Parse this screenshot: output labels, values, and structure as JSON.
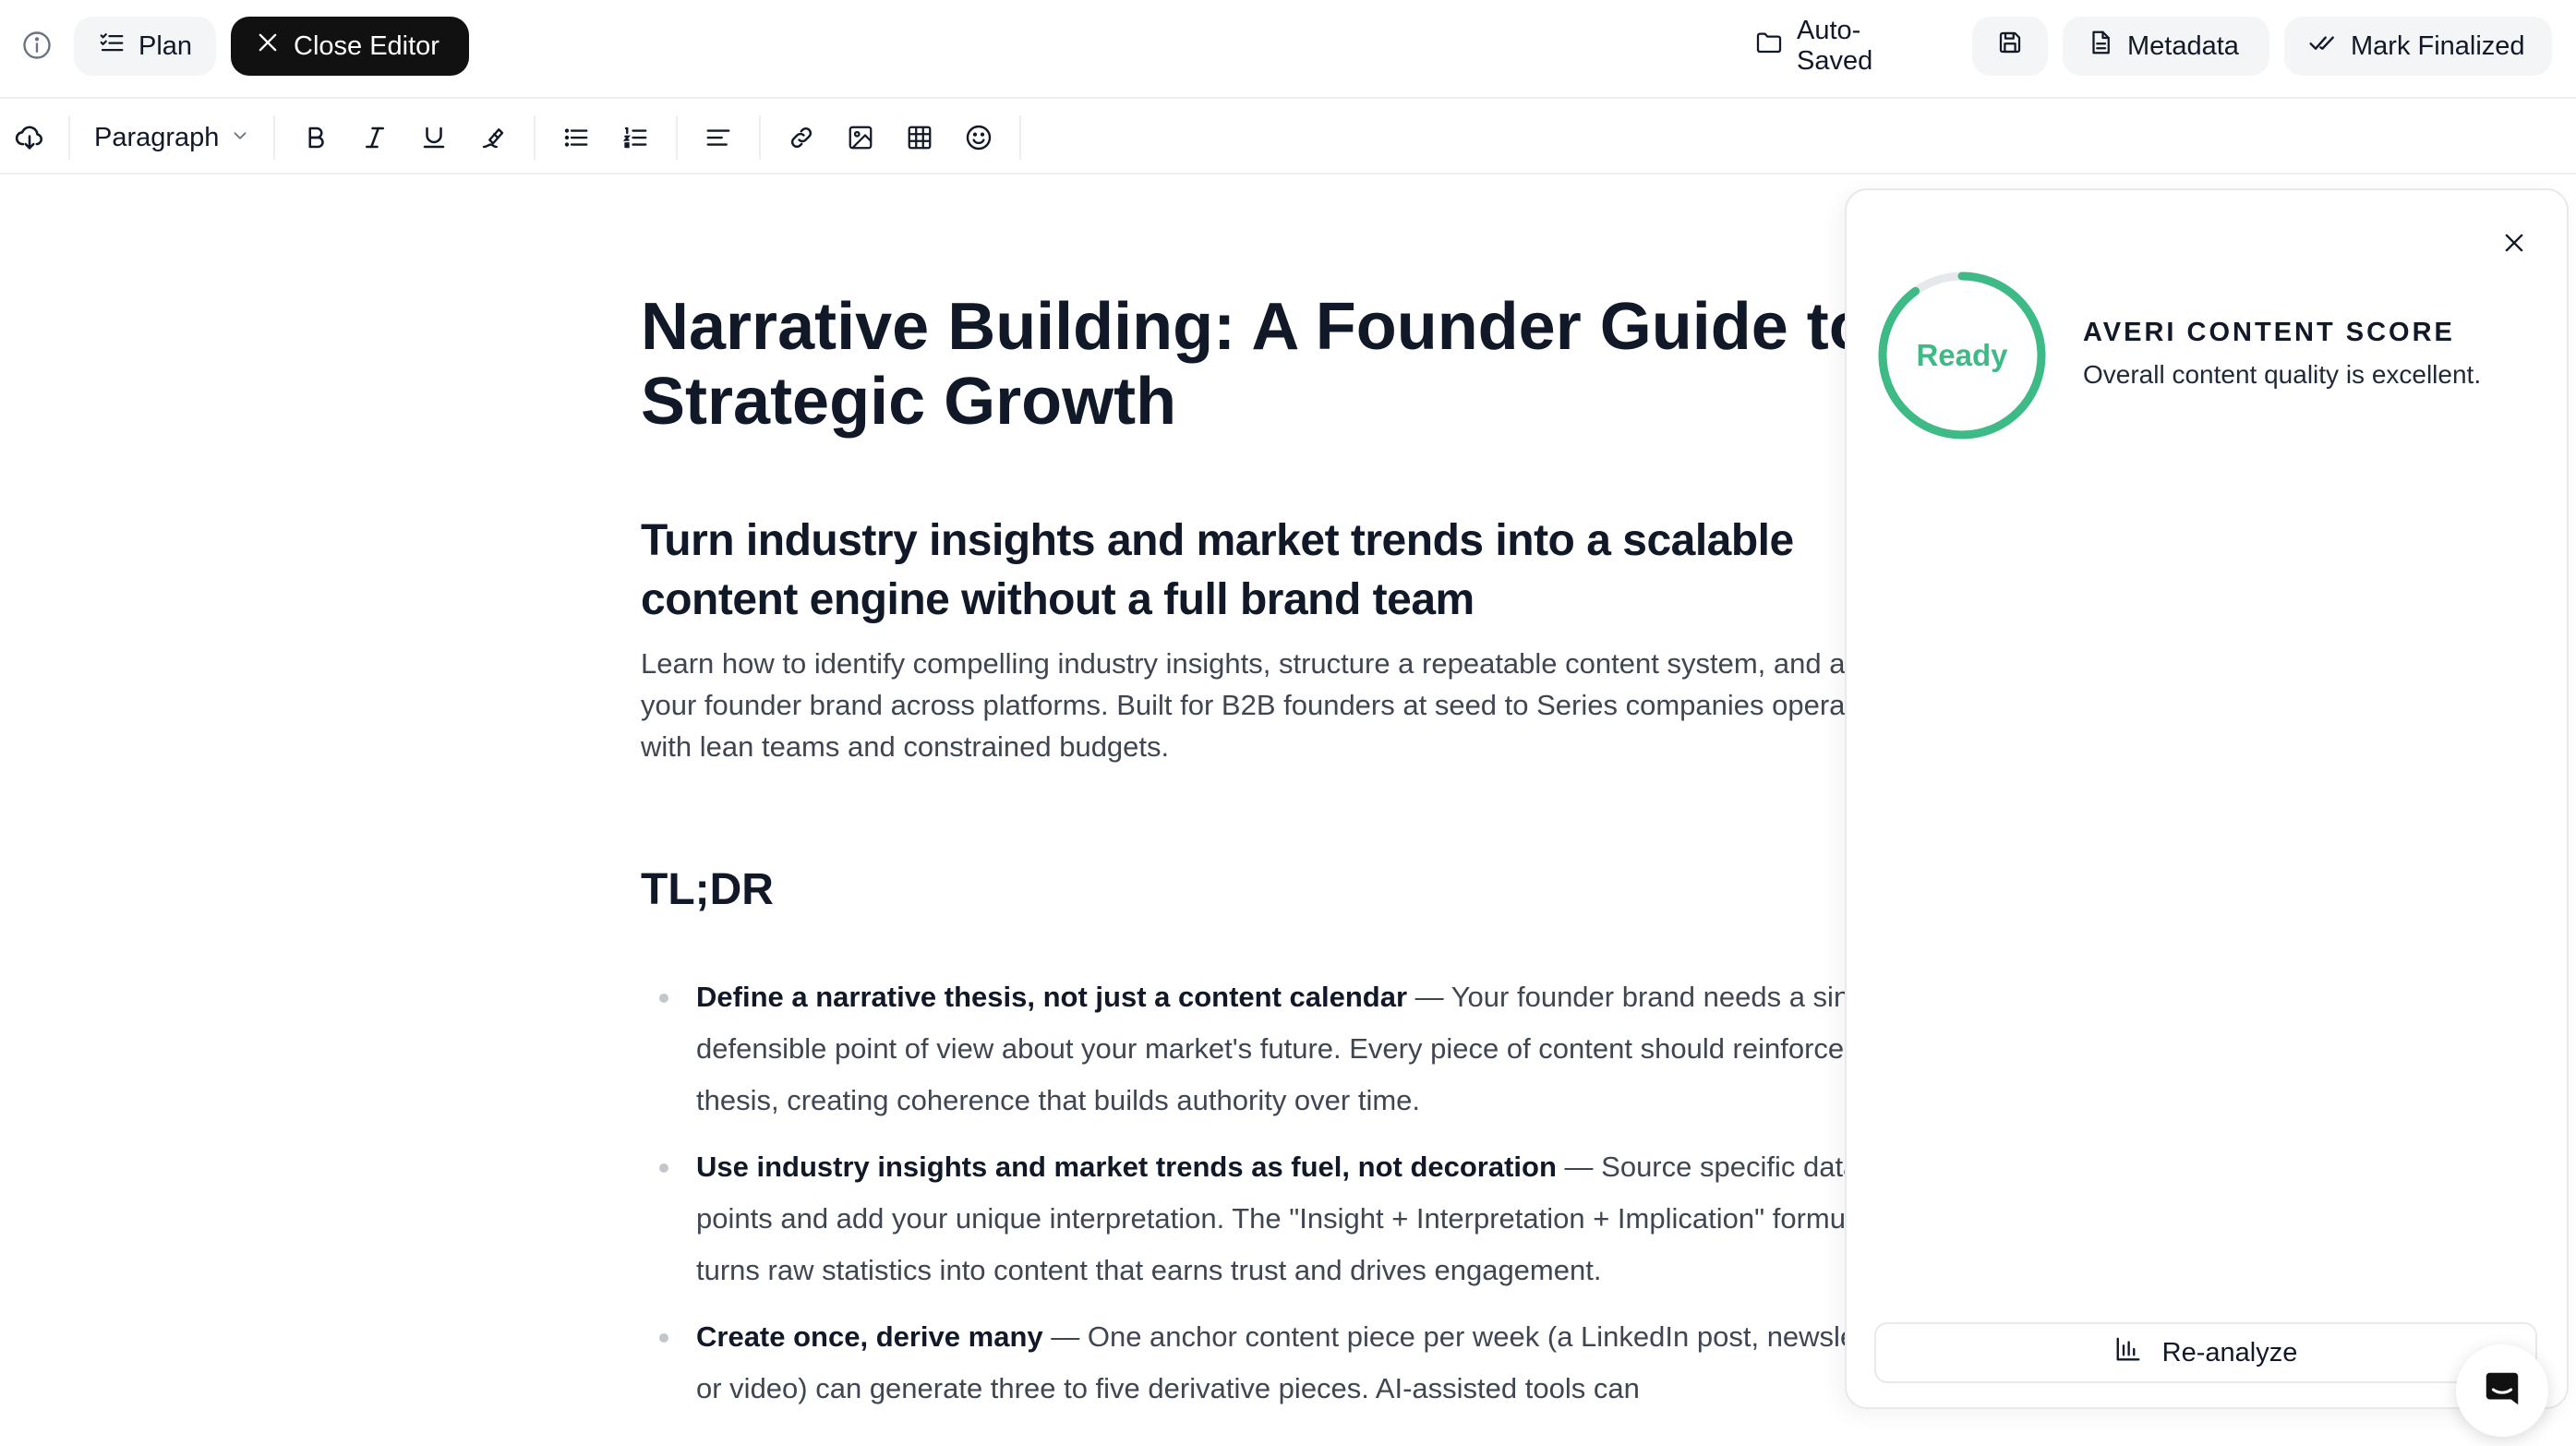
{
  "topbar": {
    "plan_label": "Plan",
    "close_editor_label": "Close Editor",
    "autosaved_label": "Auto-Saved",
    "metadata_label": "Metadata",
    "mark_finalized_label": "Mark Finalized",
    "icons": [
      "info-icon",
      "plan-list-icon",
      "close-icon",
      "folder-icon",
      "save-icon",
      "document-icon",
      "double-check-icon"
    ]
  },
  "toolbar": {
    "block_style": "Paragraph",
    "icons": [
      "cloud-download-icon",
      "chevron-down-icon",
      "bold-icon",
      "italic-icon",
      "underline-icon",
      "clear-format-icon",
      "bullet-list-icon",
      "numbered-list-icon",
      "align-left-icon",
      "link-icon",
      "image-icon",
      "table-icon",
      "emoji-icon"
    ]
  },
  "document": {
    "title": "Narrative Building: A Founder Guide to Strategic Growth",
    "subtitle": "Turn industry insights and market trends into a scalable content engine without a full brand team",
    "description": "Learn how to identify compelling industry insights, structure a repeatable content system, and amplify your founder brand across platforms. Built for B2B founders at seed to Series companies operating with lean teams and constrained budgets.",
    "tldr_heading": "TL;DR",
    "bullets": [
      {
        "lead": "Define a narrative thesis, not just a content calendar",
        "text": " — Your founder brand needs a single, defensible point of view about your market's future. Every piece of content should reinforce this thesis, creating coherence that builds authority over time."
      },
      {
        "lead": "Use industry insights and market trends as fuel, not decoration",
        "text": " — Source specific data points and add your unique interpretation. The \"Insight + Interpretation + Implication\" formula turns raw statistics into content that earns trust and drives engagement."
      },
      {
        "lead": "Create once, derive many",
        "text": " — One anchor content piece per week (a LinkedIn post, newsletter, or video) can generate three to five derivative pieces. AI-assisted tools can"
      }
    ]
  },
  "score_panel": {
    "status": "Ready",
    "progress": 0.9,
    "heading": "AVERI CONTENT SCORE",
    "description": "Overall content quality is excellent.",
    "reanalyze_label": "Re-analyze",
    "ring_color": "#3dba86",
    "ring_track_color": "#e6e9ec",
    "icons": [
      "close-icon",
      "bar-chart-icon"
    ]
  },
  "chat_launcher": {
    "icon": "chat-icon"
  }
}
